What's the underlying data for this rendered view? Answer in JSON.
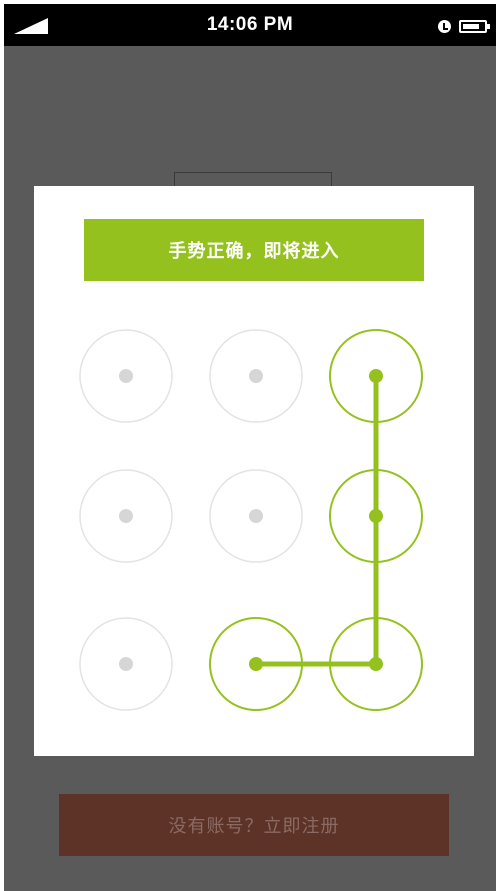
{
  "status_bar": {
    "time": "14:06 PM",
    "battery_level": 0.8,
    "icons": [
      "signal-icon",
      "alarm-icon",
      "battery-icon"
    ]
  },
  "dialog": {
    "banner_text": "手势正确，即将进入",
    "pattern": {
      "grid_size": 3,
      "selected_sequence": [
        2,
        5,
        8,
        7
      ]
    }
  },
  "register_button": {
    "label": "没有账号？立即注册"
  },
  "colors": {
    "accent": "#95c11f",
    "inactive_ring": "#e3e3e3",
    "inactive_dot": "#d6d6d6",
    "backdrop": "#5a5a5a",
    "button_bg": "#5e3327",
    "button_text": "#8a6a63"
  }
}
